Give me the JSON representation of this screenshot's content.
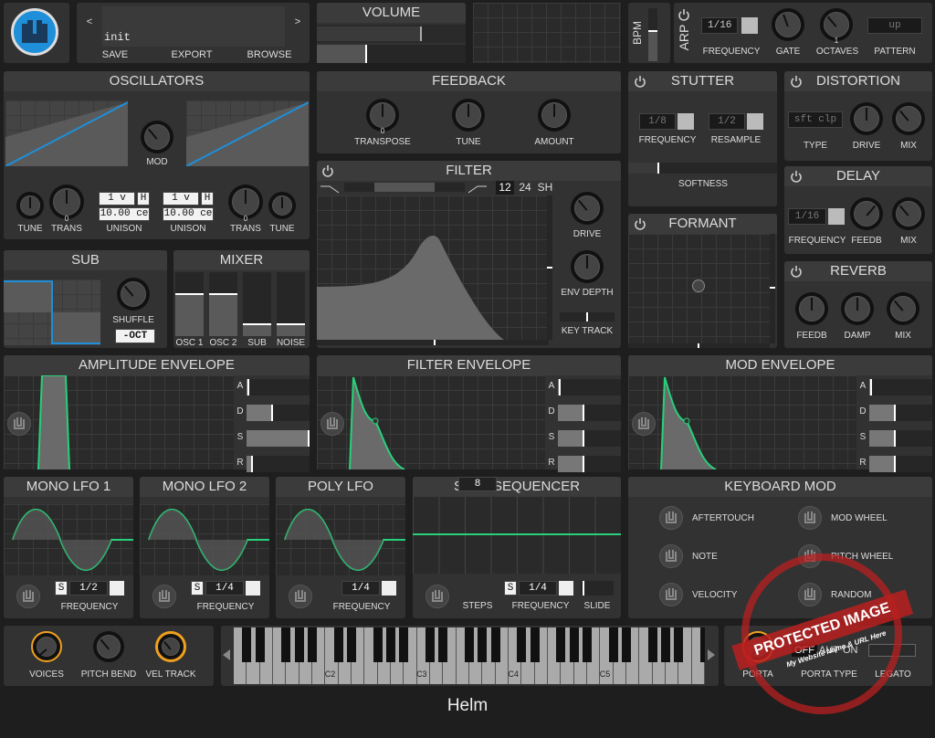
{
  "app_title": "Helm",
  "preset": {
    "name": "init",
    "prev": "<",
    "next": ">",
    "save": "SAVE",
    "export": "EXPORT",
    "browse": "BROWSE"
  },
  "volume": {
    "title": "VOLUME",
    "level": 0.33
  },
  "bpm": {
    "label": "BPM"
  },
  "arp": {
    "label": "ARP",
    "frequency_value": "1/16",
    "frequency": "FREQUENCY",
    "gate": "GATE",
    "octaves": "OCTAVES",
    "octaves_value": "1",
    "pattern": "PATTERN",
    "pattern_value": "up"
  },
  "oscillators": {
    "title": "OSCILLATORS",
    "mod": "MOD",
    "tune1": "TUNE",
    "trans1": "TRANS",
    "trans1_value": "0",
    "unison1": "UNISON",
    "unison1_voices": "1 v",
    "unison1_h": "H",
    "unison1_cents": "10.00 ce",
    "unison2": "UNISON",
    "unison2_voices": "1 v",
    "unison2_h": "H",
    "unison2_cents": "10.00 ce",
    "trans2": "TRANS",
    "trans2_value": "0",
    "tune2": "TUNE"
  },
  "feedback": {
    "title": "FEEDBACK",
    "transpose": "TRANSPOSE",
    "transpose_value": "0",
    "tune": "TUNE",
    "amount": "AMOUNT"
  },
  "filter": {
    "title": "FILTER",
    "slope12": "12",
    "slope24": "24",
    "sh": "SH",
    "drive": "DRIVE",
    "env_depth": "ENV DEPTH",
    "key_track": "KEY TRACK"
  },
  "stutter": {
    "title": "STUTTER",
    "frequency_value": "1/8",
    "frequency": "FREQUENCY",
    "resample_value": "1/2",
    "resample": "RESAMPLE",
    "softness": "SOFTNESS"
  },
  "formant": {
    "title": "FORMANT"
  },
  "distortion": {
    "title": "DISTORTION",
    "type_value": "sft clp",
    "type": "TYPE",
    "drive": "DRIVE",
    "mix": "MIX"
  },
  "delay": {
    "title": "DELAY",
    "frequency_value": "1/16",
    "frequency": "FREQUENCY",
    "feedb": "FEEDB",
    "mix": "MIX"
  },
  "reverb": {
    "title": "REVERB",
    "feedb": "FEEDB",
    "damp": "DAMP",
    "mix": "MIX"
  },
  "sub": {
    "title": "SUB",
    "shuffle": "SHUFFLE",
    "octave_value": "-OCT"
  },
  "mixer": {
    "title": "MIXER",
    "channels": [
      {
        "label": "OSC 1",
        "level": 0.75
      },
      {
        "label": "OSC 2",
        "level": 0.75
      },
      {
        "label": "SUB",
        "level": 0.2
      },
      {
        "label": "NOISE",
        "level": 0.2
      }
    ]
  },
  "envelopes": {
    "amp": {
      "title": "AMPLITUDE ENVELOPE",
      "adsr": [
        {
          "name": "A",
          "level": 0.05
        },
        {
          "name": "D",
          "level": 0.42
        },
        {
          "name": "S",
          "level": 1.0
        },
        {
          "name": "R",
          "level": 0.1
        }
      ]
    },
    "filter": {
      "title": "FILTER ENVELOPE",
      "adsr": [
        {
          "name": "A",
          "level": 0.05
        },
        {
          "name": "D",
          "level": 0.42
        },
        {
          "name": "S",
          "level": 0.42
        },
        {
          "name": "R",
          "level": 0.42
        }
      ]
    },
    "mod": {
      "title": "MOD ENVELOPE",
      "adsr": [
        {
          "name": "A",
          "level": 0.05
        },
        {
          "name": "D",
          "level": 0.42
        },
        {
          "name": "S",
          "level": 0.42
        },
        {
          "name": "R",
          "level": 0.42
        }
      ]
    }
  },
  "lfos": [
    {
      "title": "MONO LFO 1",
      "sync": "S",
      "value": "1/2",
      "frequency": "FREQUENCY"
    },
    {
      "title": "MONO LFO 2",
      "sync": "S",
      "value": "1/4",
      "frequency": "FREQUENCY"
    },
    {
      "title": "POLY LFO",
      "value": "1/4",
      "frequency": "FREQUENCY"
    }
  ],
  "step_sequencer": {
    "title": "STEP SEQUENCER",
    "steps_value": "8",
    "steps": "STEPS",
    "sync": "S",
    "frequency_value": "1/4",
    "frequency": "FREQUENCY",
    "slide": "SLIDE"
  },
  "keyboard_mod": {
    "title": "KEYBOARD MOD",
    "items": [
      "AFTERTOUCH",
      "MOD WHEEL",
      "NOTE",
      "PITCH WHEEL",
      "VELOCITY",
      "RANDOM"
    ]
  },
  "bottom": {
    "voices": "VOICES",
    "pitch_bend": "PITCH BEND",
    "vel_track": "VEL TRACK",
    "octave_labels": [
      "C2",
      "C3",
      "C4",
      "C5"
    ],
    "porta": "PORTA",
    "porta_type": "PORTA TYPE",
    "legato": "LEGATO",
    "porta_off": "OFF",
    "porta_aut": "AUT",
    "porta_on": "ON"
  },
  "watermark": {
    "title": "PROTECTED IMAGE",
    "sub": "My Website Name & URL Here"
  },
  "colors": {
    "accent_green": "#28d07a",
    "accent_blue": "#1e8fd8",
    "accent_orange": "#f0a020",
    "watermark": "#b82020"
  }
}
